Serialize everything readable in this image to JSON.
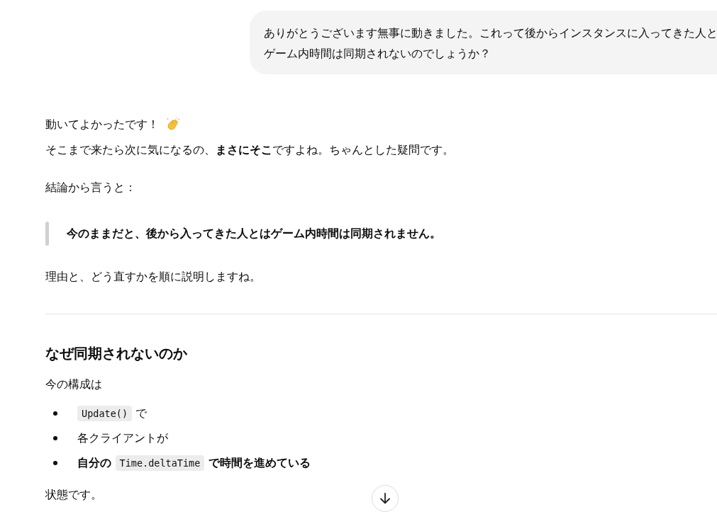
{
  "user_message": {
    "text": "ありがとうございます無事に動きました。これって後からインスタンスに入ってきた人とゲーム内時間は同期されないのでしょうか？"
  },
  "reply": [
    {
      "kind": "cheer",
      "text": "動いてよかったです！"
    },
    {
      "kind": "line",
      "text": "そこまで来たら次に気になるの、**まさにそこ**ですよね。ちゃんとした疑問です。"
    },
    {
      "kind": "paragraph",
      "text": "結論から言うと："
    },
    {
      "kind": "quote",
      "text": "今のままだと、後から入ってきた人とはゲーム内時間は同期されません。"
    },
    {
      "kind": "paragraph",
      "text": "理由と、どう直すかを順に説明しますね。"
    },
    {
      "kind": "rule"
    },
    {
      "kind": "heading",
      "text": "なぜ同期されないのか"
    },
    {
      "kind": "paragraph",
      "text": "今の構成は"
    },
    {
      "kind": "list",
      "items": [
        {
          "bold": false,
          "parts": [
            {
              "kind": "code",
              "text": "Update()"
            },
            {
              "kind": "text",
              "text": " で"
            }
          ]
        },
        {
          "bold": false,
          "parts": [
            {
              "kind": "text",
              "text": "各クライアントが"
            }
          ]
        },
        {
          "bold": true,
          "parts": [
            {
              "kind": "text",
              "text": "自分の "
            },
            {
              "kind": "code",
              "text": "Time.deltaTime"
            },
            {
              "kind": "text",
              "text": " で時間を進めている"
            }
          ]
        }
      ]
    },
    {
      "kind": "paragraph",
      "text": "状態です。"
    }
  ]
}
